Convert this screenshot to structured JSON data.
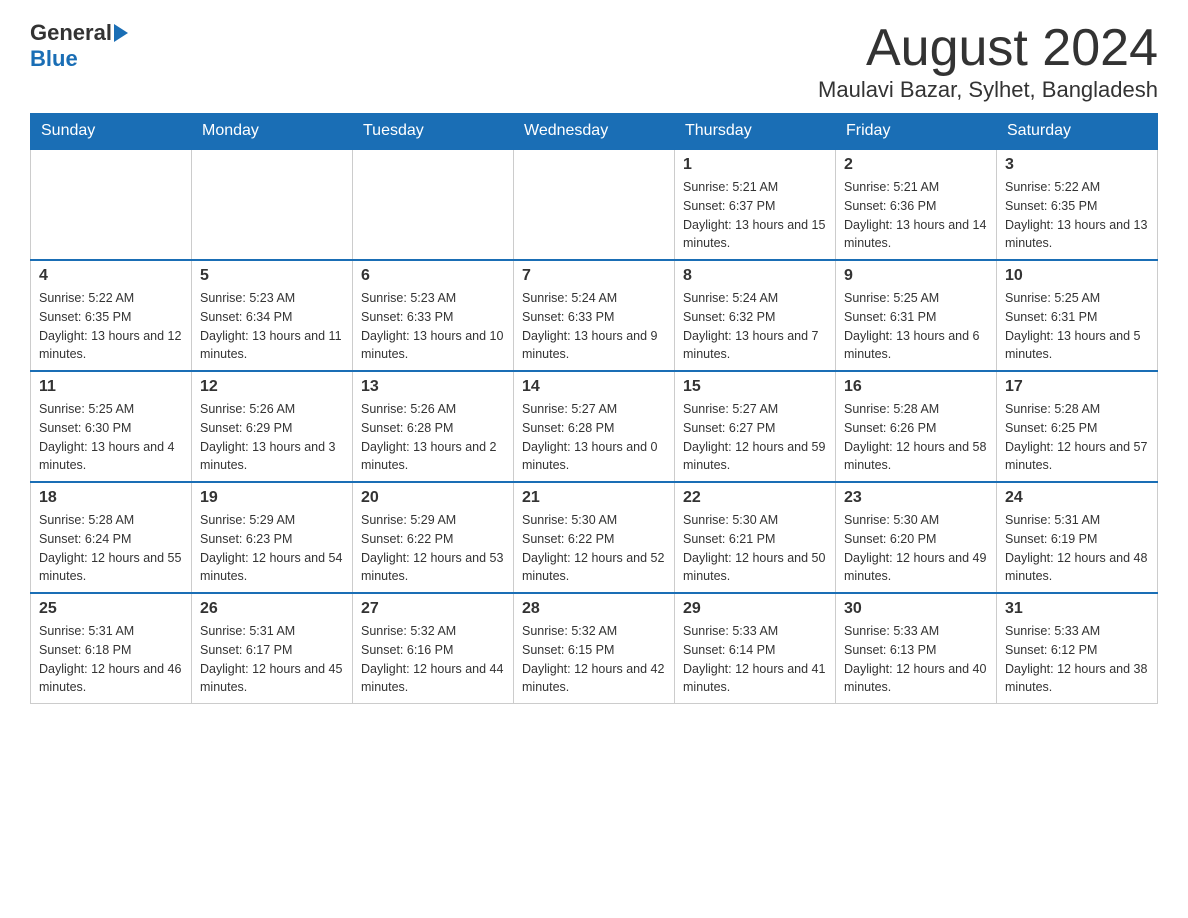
{
  "header": {
    "logo_general": "General",
    "logo_blue": "Blue",
    "month_title": "August 2024",
    "location": "Maulavi Bazar, Sylhet, Bangladesh"
  },
  "days_of_week": [
    "Sunday",
    "Monday",
    "Tuesday",
    "Wednesday",
    "Thursday",
    "Friday",
    "Saturday"
  ],
  "weeks": [
    {
      "days": [
        {
          "number": "",
          "info": ""
        },
        {
          "number": "",
          "info": ""
        },
        {
          "number": "",
          "info": ""
        },
        {
          "number": "",
          "info": ""
        },
        {
          "number": "1",
          "info": "Sunrise: 5:21 AM\nSunset: 6:37 PM\nDaylight: 13 hours and 15 minutes."
        },
        {
          "number": "2",
          "info": "Sunrise: 5:21 AM\nSunset: 6:36 PM\nDaylight: 13 hours and 14 minutes."
        },
        {
          "number": "3",
          "info": "Sunrise: 5:22 AM\nSunset: 6:35 PM\nDaylight: 13 hours and 13 minutes."
        }
      ]
    },
    {
      "days": [
        {
          "number": "4",
          "info": "Sunrise: 5:22 AM\nSunset: 6:35 PM\nDaylight: 13 hours and 12 minutes."
        },
        {
          "number": "5",
          "info": "Sunrise: 5:23 AM\nSunset: 6:34 PM\nDaylight: 13 hours and 11 minutes."
        },
        {
          "number": "6",
          "info": "Sunrise: 5:23 AM\nSunset: 6:33 PM\nDaylight: 13 hours and 10 minutes."
        },
        {
          "number": "7",
          "info": "Sunrise: 5:24 AM\nSunset: 6:33 PM\nDaylight: 13 hours and 9 minutes."
        },
        {
          "number": "8",
          "info": "Sunrise: 5:24 AM\nSunset: 6:32 PM\nDaylight: 13 hours and 7 minutes."
        },
        {
          "number": "9",
          "info": "Sunrise: 5:25 AM\nSunset: 6:31 PM\nDaylight: 13 hours and 6 minutes."
        },
        {
          "number": "10",
          "info": "Sunrise: 5:25 AM\nSunset: 6:31 PM\nDaylight: 13 hours and 5 minutes."
        }
      ]
    },
    {
      "days": [
        {
          "number": "11",
          "info": "Sunrise: 5:25 AM\nSunset: 6:30 PM\nDaylight: 13 hours and 4 minutes."
        },
        {
          "number": "12",
          "info": "Sunrise: 5:26 AM\nSunset: 6:29 PM\nDaylight: 13 hours and 3 minutes."
        },
        {
          "number": "13",
          "info": "Sunrise: 5:26 AM\nSunset: 6:28 PM\nDaylight: 13 hours and 2 minutes."
        },
        {
          "number": "14",
          "info": "Sunrise: 5:27 AM\nSunset: 6:28 PM\nDaylight: 13 hours and 0 minutes."
        },
        {
          "number": "15",
          "info": "Sunrise: 5:27 AM\nSunset: 6:27 PM\nDaylight: 12 hours and 59 minutes."
        },
        {
          "number": "16",
          "info": "Sunrise: 5:28 AM\nSunset: 6:26 PM\nDaylight: 12 hours and 58 minutes."
        },
        {
          "number": "17",
          "info": "Sunrise: 5:28 AM\nSunset: 6:25 PM\nDaylight: 12 hours and 57 minutes."
        }
      ]
    },
    {
      "days": [
        {
          "number": "18",
          "info": "Sunrise: 5:28 AM\nSunset: 6:24 PM\nDaylight: 12 hours and 55 minutes."
        },
        {
          "number": "19",
          "info": "Sunrise: 5:29 AM\nSunset: 6:23 PM\nDaylight: 12 hours and 54 minutes."
        },
        {
          "number": "20",
          "info": "Sunrise: 5:29 AM\nSunset: 6:22 PM\nDaylight: 12 hours and 53 minutes."
        },
        {
          "number": "21",
          "info": "Sunrise: 5:30 AM\nSunset: 6:22 PM\nDaylight: 12 hours and 52 minutes."
        },
        {
          "number": "22",
          "info": "Sunrise: 5:30 AM\nSunset: 6:21 PM\nDaylight: 12 hours and 50 minutes."
        },
        {
          "number": "23",
          "info": "Sunrise: 5:30 AM\nSunset: 6:20 PM\nDaylight: 12 hours and 49 minutes."
        },
        {
          "number": "24",
          "info": "Sunrise: 5:31 AM\nSunset: 6:19 PM\nDaylight: 12 hours and 48 minutes."
        }
      ]
    },
    {
      "days": [
        {
          "number": "25",
          "info": "Sunrise: 5:31 AM\nSunset: 6:18 PM\nDaylight: 12 hours and 46 minutes."
        },
        {
          "number": "26",
          "info": "Sunrise: 5:31 AM\nSunset: 6:17 PM\nDaylight: 12 hours and 45 minutes."
        },
        {
          "number": "27",
          "info": "Sunrise: 5:32 AM\nSunset: 6:16 PM\nDaylight: 12 hours and 44 minutes."
        },
        {
          "number": "28",
          "info": "Sunrise: 5:32 AM\nSunset: 6:15 PM\nDaylight: 12 hours and 42 minutes."
        },
        {
          "number": "29",
          "info": "Sunrise: 5:33 AM\nSunset: 6:14 PM\nDaylight: 12 hours and 41 minutes."
        },
        {
          "number": "30",
          "info": "Sunrise: 5:33 AM\nSunset: 6:13 PM\nDaylight: 12 hours and 40 minutes."
        },
        {
          "number": "31",
          "info": "Sunrise: 5:33 AM\nSunset: 6:12 PM\nDaylight: 12 hours and 38 minutes."
        }
      ]
    }
  ]
}
